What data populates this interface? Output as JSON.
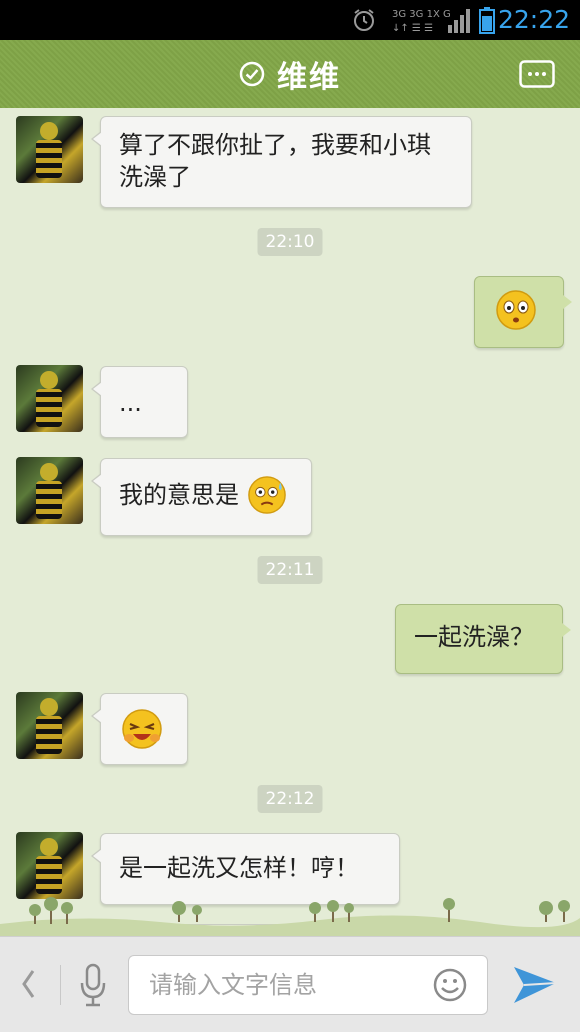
{
  "status_bar": {
    "time": "22:22",
    "network": "3G 3G 1X G",
    "icons": [
      "alarm-icon",
      "network-icon",
      "signal-icon",
      "battery-icon"
    ]
  },
  "header": {
    "title": "维维",
    "verified_icon": "check-circle-icon",
    "menu_icon": "more-icon"
  },
  "messages": [
    {
      "side": "in",
      "text": "算了不跟你扯了，我要和小琪洗澡了"
    },
    {
      "timestamp": "22:10"
    },
    {
      "side": "out",
      "emoji": "surprised-face-icon"
    },
    {
      "side": "in",
      "text": "..."
    },
    {
      "side": "in",
      "text": "我的意思是",
      "emoji": "sweat-face-icon"
    },
    {
      "timestamp": "22:11"
    },
    {
      "side": "out",
      "text": "一起洗澡？"
    },
    {
      "side": "in",
      "emoji": "laughing-face-icon"
    },
    {
      "timestamp": "22:12"
    },
    {
      "side": "in",
      "text": "是一起洗又怎样！哼！"
    }
  ],
  "input_bar": {
    "placeholder": "请输入文字信息",
    "icons": [
      "back-icon",
      "microphone-icon",
      "smiley-icon",
      "send-icon"
    ]
  },
  "colors": {
    "header": "#82a64a",
    "chat_background": "#e4ecd6",
    "outgoing_bubble": "#cfe0a8",
    "incoming_bubble": "#f5f5f3",
    "status_time": "#38a4ec"
  }
}
